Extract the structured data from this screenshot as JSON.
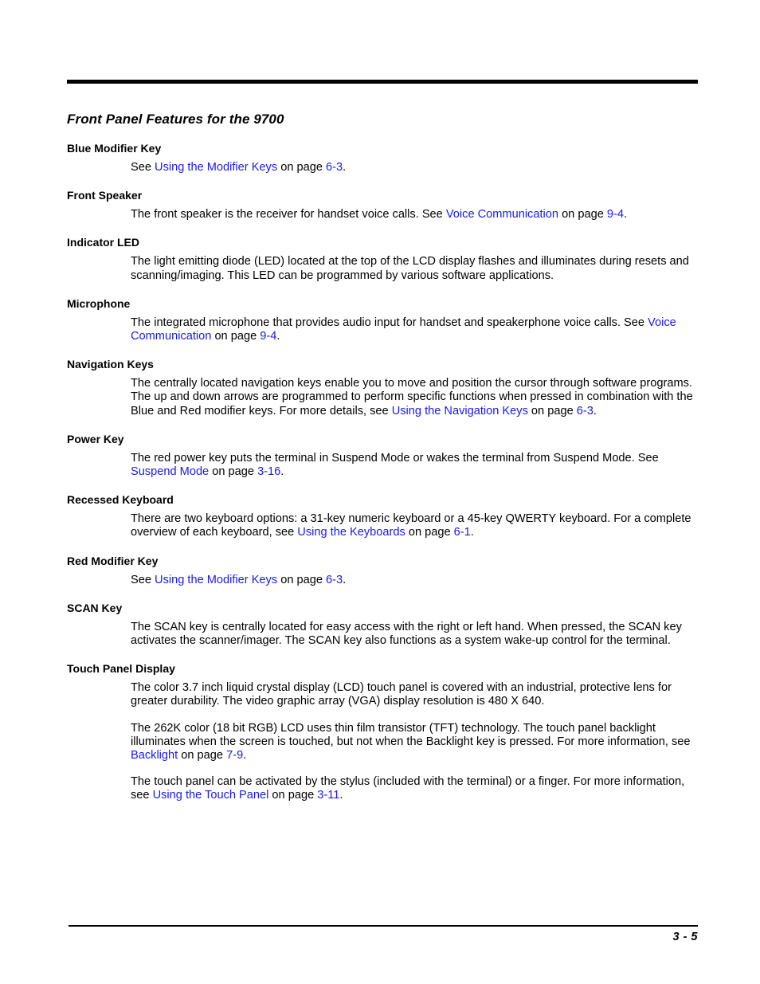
{
  "document": {
    "page_title": "Front Panel Features for the 9700",
    "footer_page_number": "3 - 5",
    "link_color": "#1a1ae6"
  },
  "sections": [
    {
      "heading": "Blue Modifier Key",
      "paragraphs": [
        {
          "runs": [
            {
              "text": "See ",
              "link": false
            },
            {
              "text": "Using the Modifier Keys",
              "link": true
            },
            {
              "text": " on page ",
              "link": false
            },
            {
              "text": "6-3",
              "link": true
            },
            {
              "text": ".",
              "link": false
            }
          ]
        }
      ]
    },
    {
      "heading": "Front Speaker",
      "paragraphs": [
        {
          "runs": [
            {
              "text": "The front speaker is the receiver for handset voice calls. See ",
              "link": false
            },
            {
              "text": "Voice Communication",
              "link": true
            },
            {
              "text": " on page ",
              "link": false
            },
            {
              "text": "9-4",
              "link": true
            },
            {
              "text": ".",
              "link": false
            }
          ]
        }
      ]
    },
    {
      "heading": "Indicator LED",
      "paragraphs": [
        {
          "runs": [
            {
              "text": "The light emitting diode (LED) located at the top of the LCD display flashes and illuminates during resets and scanning/imaging. This LED can be programmed by various software applications.",
              "link": false
            }
          ]
        }
      ]
    },
    {
      "heading": "Microphone",
      "paragraphs": [
        {
          "runs": [
            {
              "text": "The integrated microphone that provides audio input for handset and speakerphone voice calls. See ",
              "link": false
            },
            {
              "text": "Voice Communication",
              "link": true
            },
            {
              "text": " on page ",
              "link": false
            },
            {
              "text": "9-4",
              "link": true
            },
            {
              "text": ".",
              "link": false
            }
          ]
        }
      ]
    },
    {
      "heading": "Navigation Keys",
      "paragraphs": [
        {
          "runs": [
            {
              "text": "The centrally located navigation keys enable you to move and position the cursor through software programs. The up and down arrows are programmed to perform specific functions when pressed in combination with the Blue and Red modifier keys. For more details, see ",
              "link": false
            },
            {
              "text": "Using the Navigation Keys",
              "link": true
            },
            {
              "text": " on page ",
              "link": false
            },
            {
              "text": "6-3",
              "link": true
            },
            {
              "text": ".",
              "link": false
            }
          ]
        }
      ]
    },
    {
      "heading": "Power Key",
      "paragraphs": [
        {
          "runs": [
            {
              "text": "The red power key puts the terminal in Suspend Mode or wakes the terminal from Suspend Mode. See ",
              "link": false
            },
            {
              "text": "Suspend Mode",
              "link": true
            },
            {
              "text": " on page ",
              "link": false
            },
            {
              "text": "3-16",
              "link": true
            },
            {
              "text": ".",
              "link": false
            }
          ]
        }
      ]
    },
    {
      "heading": "Recessed Keyboard",
      "paragraphs": [
        {
          "runs": [
            {
              "text": "There are two keyboard options: a 31-key numeric keyboard or a 45-key QWERTY keyboard. For a complete overview of each keyboard, see ",
              "link": false
            },
            {
              "text": "Using the Keyboards",
              "link": true
            },
            {
              "text": " on page ",
              "link": false
            },
            {
              "text": "6-1",
              "link": true
            },
            {
              "text": ".",
              "link": false
            }
          ]
        }
      ]
    },
    {
      "heading": "Red Modifier Key",
      "paragraphs": [
        {
          "runs": [
            {
              "text": "See ",
              "link": false
            },
            {
              "text": "Using the Modifier Keys",
              "link": true
            },
            {
              "text": " on page ",
              "link": false
            },
            {
              "text": "6-3",
              "link": true
            },
            {
              "text": ".",
              "link": false
            }
          ]
        }
      ]
    },
    {
      "heading": "SCAN Key",
      "paragraphs": [
        {
          "runs": [
            {
              "text": "The SCAN key is centrally located for easy access with the right or left hand. When pressed, the SCAN key activates the scanner/imager. The SCAN key also functions as a system wake-up control for the terminal.",
              "link": false
            }
          ]
        }
      ]
    },
    {
      "heading": "Touch Panel Display",
      "paragraphs": [
        {
          "runs": [
            {
              "text": "The color 3.7 inch liquid crystal display (LCD) touch panel is covered with an industrial, protective lens for greater durability. The video graphic array (VGA) display resolution is 480 X 640.",
              "link": false
            }
          ]
        },
        {
          "runs": [
            {
              "text": "The 262K color (18 bit RGB) LCD uses thin film transistor (TFT) technology. The touch panel backlight illuminates when the screen is touched, but not when the Backlight key is pressed. For more information, see ",
              "link": false
            },
            {
              "text": "Backlight",
              "link": true
            },
            {
              "text": " on page ",
              "link": false
            },
            {
              "text": "7-9",
              "link": true
            },
            {
              "text": ".",
              "link": false
            }
          ]
        },
        {
          "runs": [
            {
              "text": "The touch panel can be activated by the stylus (included with the terminal) or a finger. For more information, see ",
              "link": false
            },
            {
              "text": "Using the Touch Panel",
              "link": true
            },
            {
              "text": " on page ",
              "link": false
            },
            {
              "text": "3-11",
              "link": true
            },
            {
              "text": ".",
              "link": false
            }
          ]
        }
      ]
    }
  ]
}
